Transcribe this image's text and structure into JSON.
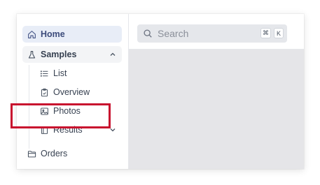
{
  "sidebar": {
    "items": [
      {
        "label": "Home",
        "icon": "home-icon"
      },
      {
        "label": "Samples",
        "icon": "flask-icon",
        "expanded": true
      },
      {
        "label": "List",
        "icon": "list-icon"
      },
      {
        "label": "Overview",
        "icon": "clipboard-icon"
      },
      {
        "label": "Photos",
        "icon": "image-icon"
      },
      {
        "label": "Results",
        "icon": "book-icon"
      },
      {
        "label": "Orders",
        "icon": "folder-icon"
      }
    ]
  },
  "search": {
    "placeholder": "Search",
    "shortcut_keys": [
      "⌘",
      "K"
    ]
  },
  "colors": {
    "highlight_border": "#c8102e",
    "active_item_bg": "#e8edf7",
    "content_bg": "#e5e5e8"
  }
}
